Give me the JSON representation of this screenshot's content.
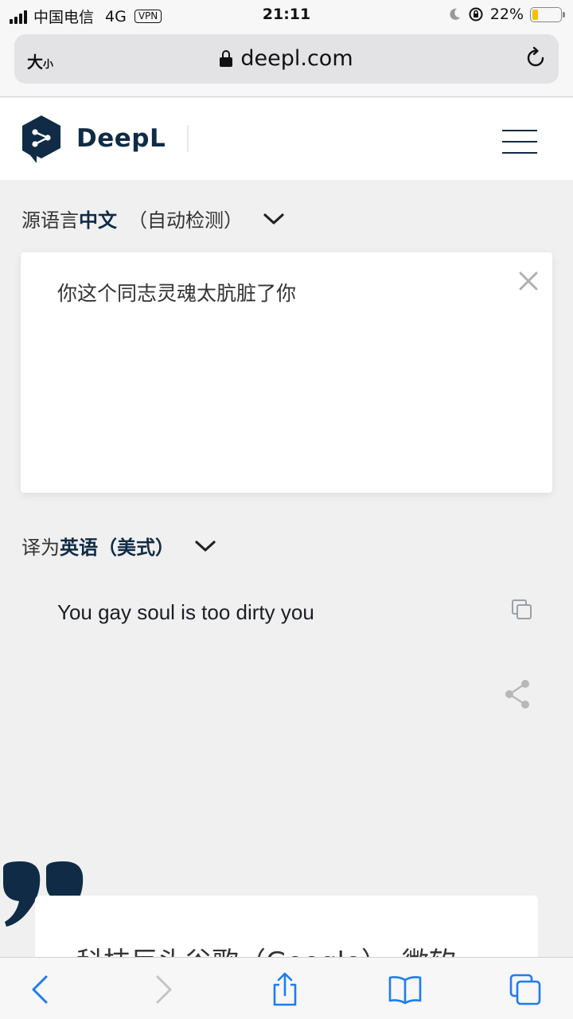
{
  "status_bar": {
    "carrier": "中国电信",
    "network": "4G",
    "vpn": "VPN",
    "time": "21:11",
    "battery_percent": "22%",
    "battery_level": 0.22,
    "battery_color": "#f2c200"
  },
  "browser": {
    "text_size_label": "大",
    "text_size_small": "小",
    "domain": "deepl.com"
  },
  "header": {
    "brand": "DeepL",
    "brand_color": "#0f2b46"
  },
  "source": {
    "prefix": "源语言",
    "language": "中文",
    "detect": "（自动检测）",
    "text": "你这个同志灵魂太肮脏了你"
  },
  "target": {
    "prefix": "译为",
    "language": "英语（美式）",
    "text": "You gay soul is too dirty you"
  },
  "quote": {
    "text": "科技巨头谷歌（Google）、微软"
  }
}
